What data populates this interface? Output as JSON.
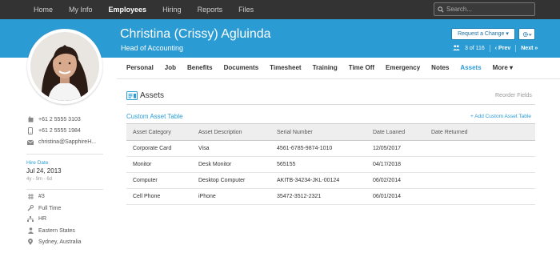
{
  "nav": {
    "items": [
      "Home",
      "My Info",
      "Employees",
      "Hiring",
      "Reports",
      "Files"
    ],
    "active_index": 2
  },
  "search": {
    "placeholder": "Search..."
  },
  "employee": {
    "name": "Christina (Crissy) Agluinda",
    "job_title": "Head of Accounting"
  },
  "header_actions": {
    "request_label": "Request a Change ▾",
    "pager_position": "3 of 116",
    "prev_label": "‹ Prev",
    "next_label": "Next »"
  },
  "tabs": {
    "items": [
      "Personal",
      "Job",
      "Benefits",
      "Documents",
      "Timesheet",
      "Training",
      "Time Off",
      "Emergency",
      "Notes",
      "Assets",
      "More ▾"
    ],
    "active_index": 9
  },
  "section": {
    "title": "Assets",
    "reorder_label": "Reorder Fields"
  },
  "asset_table": {
    "title": "Custom Asset Table",
    "add_label": "+ Add Custom Asset Table",
    "columns": [
      "Asset Category",
      "Asset Description",
      "Serial Number",
      "Date Loaned",
      "Date Returned"
    ],
    "rows": [
      [
        "Corporate Card",
        "Visa",
        "4561-6785-9874-1010",
        "12/05/2017",
        ""
      ],
      [
        "Monitor",
        "Desk Monitor",
        "565155",
        "04/17/2018",
        ""
      ],
      [
        "Computer",
        "Desktop Computer",
        "AKITB-34234-JKL-00124",
        "06/02/2014",
        ""
      ],
      [
        "Cell Phone",
        "iPhone",
        "35472-3512-2321",
        "06/01/2014",
        ""
      ]
    ]
  },
  "contact": {
    "work_phone": "+61 2 5555 3103",
    "mobile_phone": "+61 2 5555 1984",
    "email": "christina@SapphireH..."
  },
  "hire": {
    "label": "Hire Date",
    "date": "Jul 24, 2013",
    "tenure": "4y - 9m - 6d"
  },
  "details": {
    "employee_number": "#3",
    "status": "Full Time",
    "department": "HR",
    "division": "Eastern States",
    "location": "Sydney, Australia"
  },
  "colors": {
    "accent": "#2b9bd4",
    "topbar": "#333333"
  }
}
